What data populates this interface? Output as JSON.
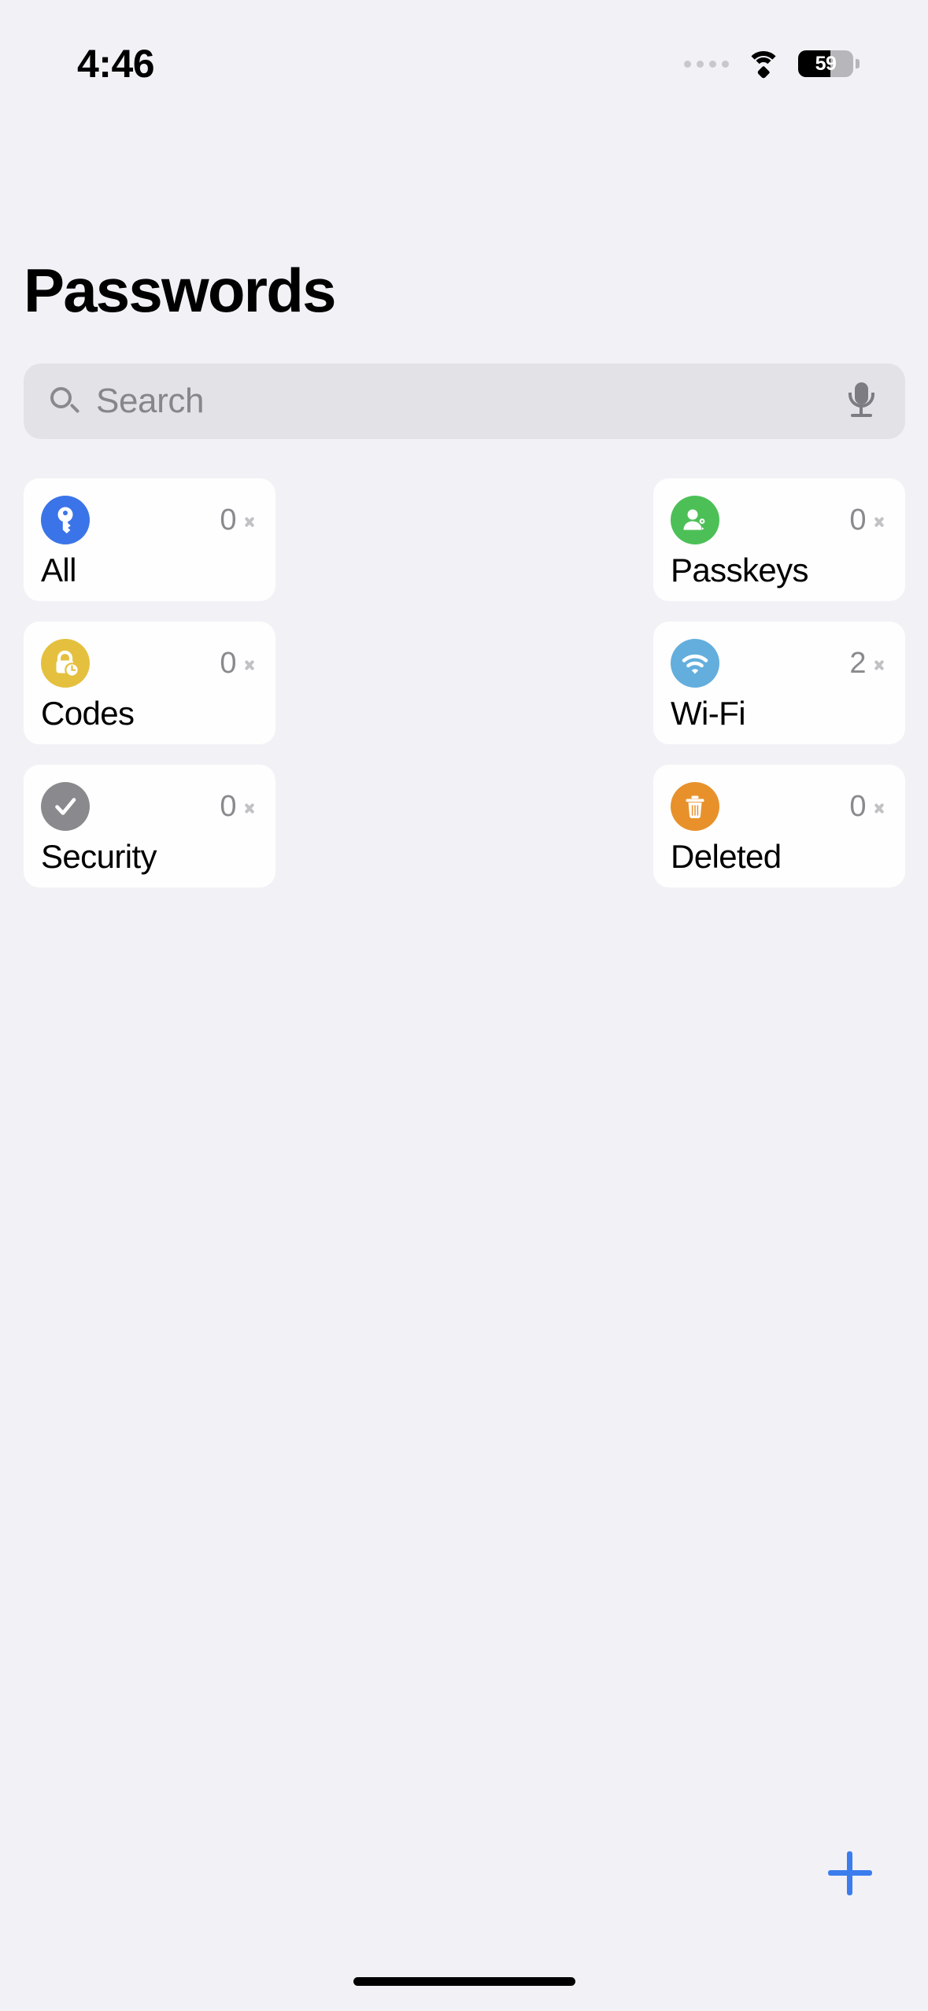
{
  "status_bar": {
    "time": "4:46",
    "battery_percent": "59",
    "battery_level": 59,
    "wifi_icon": "wifi-icon",
    "signal_icon": "signal-dots-icon",
    "battery_icon": "battery-icon"
  },
  "header": {
    "title": "Passwords"
  },
  "search": {
    "placeholder": "Search",
    "value": "",
    "search_icon": "search-icon",
    "mic_icon": "microphone-icon"
  },
  "grid": {
    "cards": [
      {
        "label": "All",
        "count": "0",
        "icon": "key-icon",
        "color": "#3a74e8",
        "name": "category-card-all"
      },
      {
        "label": "Passkeys",
        "count": "0",
        "icon": "person-key-icon",
        "color": "#4cc057",
        "name": "category-card-passkeys"
      },
      {
        "label": "Codes",
        "count": "0",
        "icon": "lock-clock-icon",
        "color": "#e5c03e",
        "name": "category-card-codes"
      },
      {
        "label": "Wi-Fi",
        "count": "2",
        "icon": "wifi-icon",
        "color": "#63aedd",
        "name": "category-card-wifi"
      },
      {
        "label": "Security",
        "count": "0",
        "icon": "checkmark-icon",
        "color": "#8a8a8e",
        "name": "category-card-security"
      },
      {
        "label": "Deleted",
        "count": "0",
        "icon": "trash-icon",
        "color": "#e8912b",
        "name": "category-card-deleted"
      }
    ]
  },
  "toolbar": {
    "add_label": "+",
    "add_icon": "plus-icon",
    "accent_color": "#3b7ded"
  },
  "theme": {
    "background": "#f2f1f6",
    "card_background": "#fefefe",
    "search_background": "#e3e2e7",
    "secondary_text": "#8a8a8e"
  }
}
